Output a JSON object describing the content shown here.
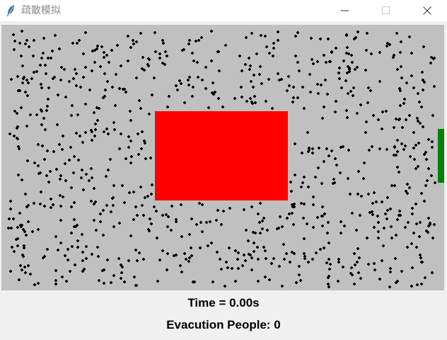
{
  "window": {
    "title": "疏散模拟",
    "icon": "feather-icon",
    "controls": {
      "minimize": "minimize-icon",
      "maximize": "maximize-icon",
      "close": "close-icon"
    }
  },
  "simulation": {
    "background_color": "#c0c0c0",
    "obstacle_color": "#ff0000",
    "exit_color": "#008000",
    "person_color": "#000000"
  },
  "status": {
    "time_text": "Time = 0.00s",
    "evacuated_text": "Evacution People: 0"
  }
}
